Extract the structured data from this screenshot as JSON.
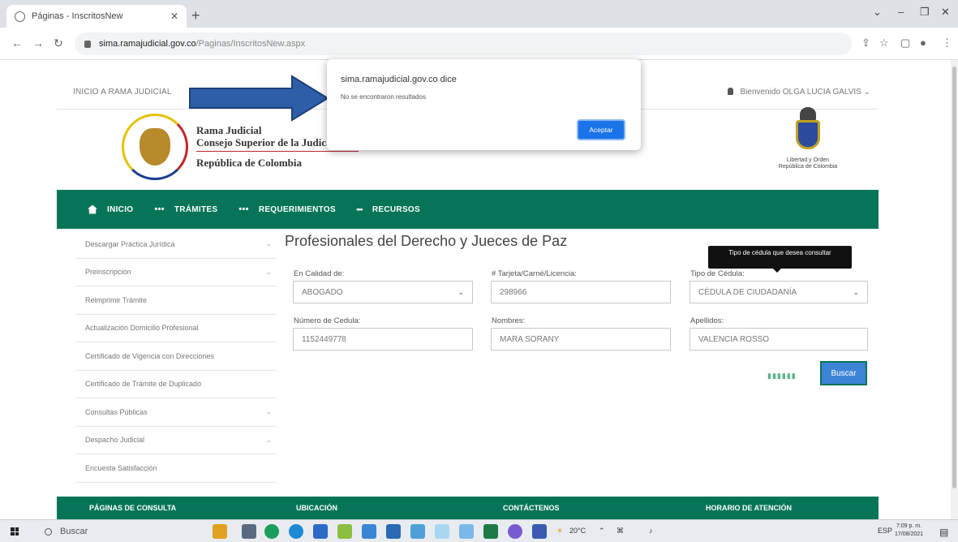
{
  "browser": {
    "tab_title": "Páginas - InscritosNew",
    "url_host": "sima.ramajudicial.gov.co",
    "url_path": "/Paginas/InscritosNew.aspx"
  },
  "header": {
    "inicio_link": "INICIO A RAMA JUDICIAL",
    "welcome": "Bienvenido OLGA LUCIA GALVIS"
  },
  "brand": {
    "line1": "Rama Judicial",
    "line2": "Consejo Superior de la Judicatura",
    "line3": "República de Colombia",
    "coat_line1": "Libertad y Orden",
    "coat_line2": "República de Colombia"
  },
  "nav": {
    "items": [
      "INICIO",
      "TRÁMITES",
      "REQUERIMIENTOS",
      "RECURSOS"
    ]
  },
  "sidebar": {
    "items": [
      "Descargar Práctica Jurídica",
      "Preinscripción",
      "Reimprimir Trámite",
      "Actualización Domicilio Profesional",
      "Certificado de Vigencia con Direcciones",
      "Certificado de Trámite de Duplicado",
      "Consultas Públicas",
      "Despacho Judicial",
      "Encuesta Satisfacción"
    ]
  },
  "form": {
    "title": "Profesionales del Derecho y Jueces de Paz",
    "calidad_label": "En Calidad de:",
    "calidad_value": "ABOGADO",
    "tarjeta_label": "# Tarjeta/Carné/Licencia:",
    "tarjeta_value": "298966",
    "tipo_label": "Tipo de Cédula:",
    "tipo_value": "CÉDULA DE CIUDADANÍA",
    "cedula_label": "Número de Cedula:",
    "cedula_value": "1152449778",
    "nombres_label": "Nombres:",
    "nombres_value": "MARA SORANY",
    "apellidos_label": "Apellidos:",
    "apellidos_value": "VALENCIA ROSSO",
    "tooltip": "Tipo de cédula que desea consultar",
    "search_button": "Buscar"
  },
  "dialog": {
    "origin": "sima.ramajudicial.gov.co dice",
    "message": "No se encontraron resultados",
    "ok_label": "Aceptar"
  },
  "footer": {
    "cols": [
      "PÁGINAS DE CONSULTA",
      "UBICACIÓN",
      "CONTÁCTENOS",
      "HORARIO DE ATENCIÓN"
    ]
  },
  "taskbar": {
    "search": "Buscar",
    "weather": "20°C",
    "lang": "ESP",
    "time": "7:09 p. m.",
    "date": "17/08/2021"
  },
  "colors": {
    "brand_green": "#067557",
    "dialog_button": "#1a73e8",
    "arrow": "#2f5ea8"
  }
}
